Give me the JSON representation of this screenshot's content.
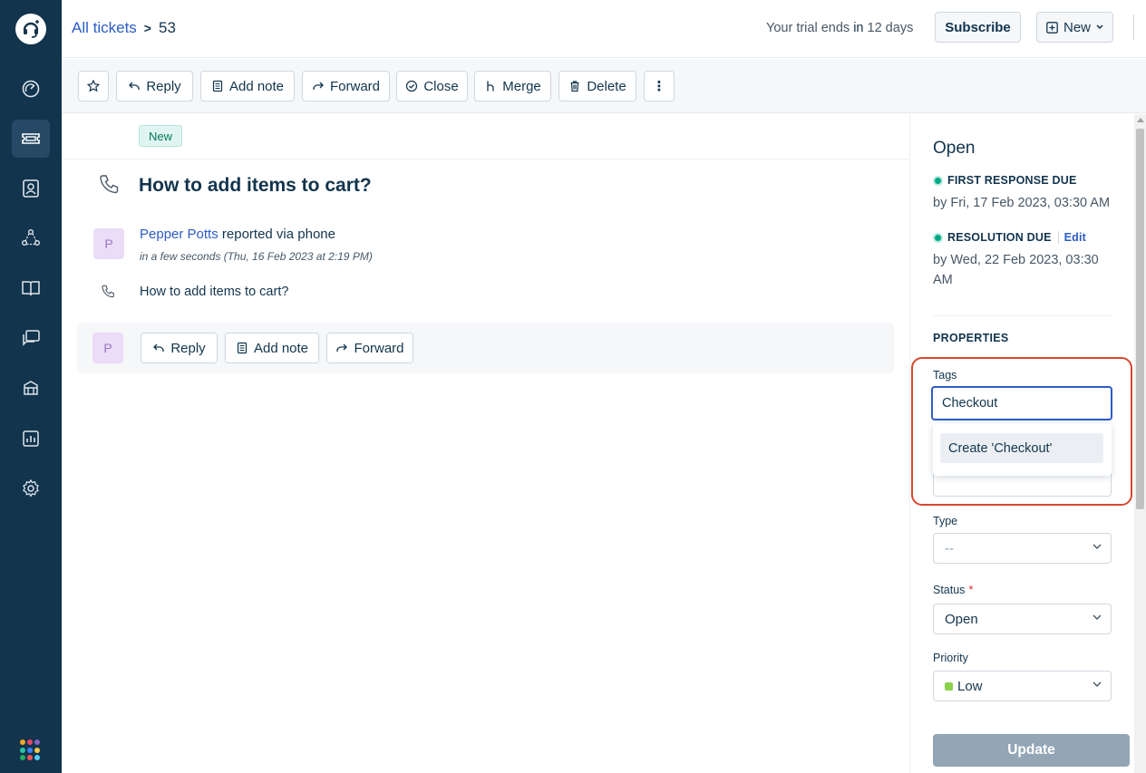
{
  "header": {
    "breadcrumb_link": "All tickets",
    "breadcrumb_separator": ">",
    "ticket_number": "53",
    "trial_prefix": "Your trial ends ",
    "trial_in": "in",
    "trial_suffix": " 12 days",
    "subscribe_label": "Subscribe",
    "new_label": "New"
  },
  "toolbar": {
    "reply_label": "Reply",
    "add_note_label": "Add note",
    "forward_label": "Forward",
    "close_label": "Close",
    "merge_label": "Merge",
    "delete_label": "Delete",
    "more_label": "⋮"
  },
  "ticket": {
    "status_badge": "New",
    "title": "How to add items to cart?",
    "requester_name": "Pepper Potts",
    "reported_via": "reported via phone",
    "timestamp": "in a few seconds (Thu, 16 Feb 2023 at 2:19 PM)",
    "avatar_initial": "P",
    "description": "How to add items to cart?"
  },
  "reply_bar": {
    "avatar_initial": "P",
    "reply_label": "Reply",
    "add_note_label": "Add note",
    "forward_label": "Forward"
  },
  "panel": {
    "status": "Open",
    "first_response_label": "FIRST RESPONSE DUE",
    "first_response_value": "by Fri, 17 Feb 2023, 03:30 AM",
    "resolution_label": "RESOLUTION DUE",
    "resolution_edit": "Edit",
    "resolution_value": "by Wed, 22 Feb 2023, 03:30 AM",
    "properties_header": "PROPERTIES",
    "tags_label": "Tags",
    "tags_value": "Checkout",
    "tags_create_option": "Create 'Checkout'",
    "type_label": "Type",
    "type_value": "--",
    "status_label": "Status",
    "status_required": "*",
    "status_value": "Open",
    "priority_label": "Priority",
    "priority_value": "Low",
    "update_label": "Update"
  },
  "colors": {
    "sidebar_bg": "#12344d",
    "link": "#2c5cc5",
    "sla_green": "#00a886",
    "highlight": "#d9472f",
    "priority_low": "#8bd14a",
    "update_btn": "#93a6b6"
  },
  "icons": {
    "sidebar": [
      "dashboard-icon",
      "tickets-icon",
      "contacts-icon",
      "groups-icon",
      "solutions-icon",
      "forums-icon",
      "admin-icon",
      "reports-icon",
      "settings-icon",
      "apps-icon"
    ]
  }
}
